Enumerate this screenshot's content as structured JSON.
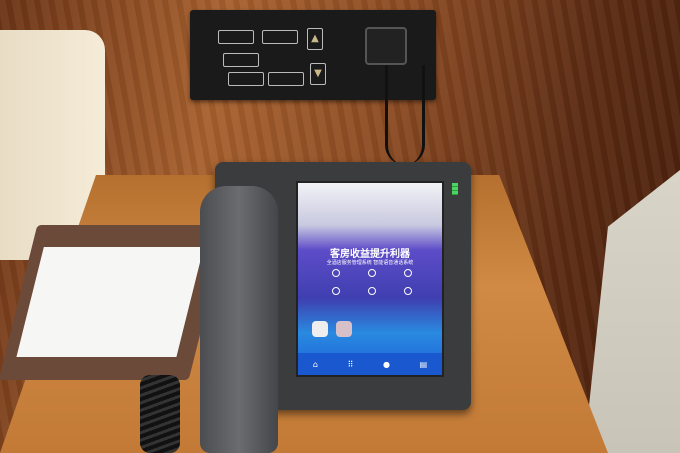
{
  "screen": {
    "headline": "客房收益提升利器",
    "subtitle": "全酒店服务管理系统 智能语音通话系统",
    "nav_icons": [
      "home-icon",
      "grid-icon",
      "person-icon",
      "document-icon"
    ]
  },
  "colors": {
    "screen_blue": "#1c5fd8",
    "wood": "#b5702f",
    "led": "#4ed06b"
  }
}
